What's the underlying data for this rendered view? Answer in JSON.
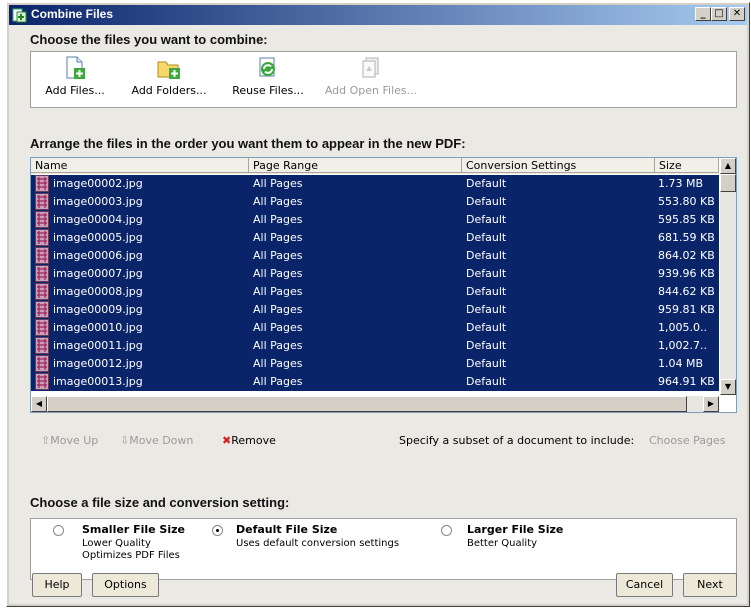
{
  "window": {
    "title": "Combine Files"
  },
  "section1": {
    "heading": "Choose the files you want to combine:"
  },
  "toolbar": {
    "add_files": "Add Files...",
    "add_folders": "Add Folders...",
    "reuse_files": "Reuse Files...",
    "add_open_files": "Add Open Files..."
  },
  "section2": {
    "heading": "Arrange the files in the order you want them to appear in the new PDF:"
  },
  "list": {
    "columns": [
      "Name",
      "Page Range",
      "Conversion Settings",
      "Size"
    ],
    "rows": [
      {
        "name": "image00002.jpg",
        "range": "All Pages",
        "conv": "Default",
        "size": "1.73 MB"
      },
      {
        "name": "image00003.jpg",
        "range": "All Pages",
        "conv": "Default",
        "size": "553.80 KB"
      },
      {
        "name": "image00004.jpg",
        "range": "All Pages",
        "conv": "Default",
        "size": "595.85 KB"
      },
      {
        "name": "image00005.jpg",
        "range": "All Pages",
        "conv": "Default",
        "size": "681.59 KB"
      },
      {
        "name": "image00006.jpg",
        "range": "All Pages",
        "conv": "Default",
        "size": "864.02 KB"
      },
      {
        "name": "image00007.jpg",
        "range": "All Pages",
        "conv": "Default",
        "size": "939.96 KB"
      },
      {
        "name": "image00008.jpg",
        "range": "All Pages",
        "conv": "Default",
        "size": "844.62 KB"
      },
      {
        "name": "image00009.jpg",
        "range": "All Pages",
        "conv": "Default",
        "size": "959.81 KB"
      },
      {
        "name": "image00010.jpg",
        "range": "All Pages",
        "conv": "Default",
        "size": "1,005.0.."
      },
      {
        "name": "image00011.jpg",
        "range": "All Pages",
        "conv": "Default",
        "size": "1,002.7.."
      },
      {
        "name": "image00012.jpg",
        "range": "All Pages",
        "conv": "Default",
        "size": "1.04 MB"
      },
      {
        "name": "image00013.jpg",
        "range": "All Pages",
        "conv": "Default",
        "size": "964.91 KB"
      }
    ]
  },
  "actions": {
    "move_up": "Move Up",
    "move_down": "Move Down",
    "remove": "Remove",
    "subset_text": "Specify a subset of a document to include:",
    "choose_pages": "Choose Pages"
  },
  "section3": {
    "heading": "Choose a file size and conversion setting:"
  },
  "options": [
    {
      "title": "Smaller File Size",
      "line1": "Lower Quality",
      "line2": "Optimizes PDF Files",
      "selected": false
    },
    {
      "title": "Default File Size",
      "line1": "Uses default conversion settings",
      "line2": "",
      "selected": true
    },
    {
      "title": "Larger File Size",
      "line1": "Better Quality",
      "line2": "",
      "selected": false
    }
  ],
  "buttons": {
    "help": "Help",
    "options": "Options",
    "cancel": "Cancel",
    "next": "Next"
  },
  "colors": {
    "selection": "#0a246a",
    "titlebar_start": "#0a246a",
    "remove_x": "#d82020"
  }
}
